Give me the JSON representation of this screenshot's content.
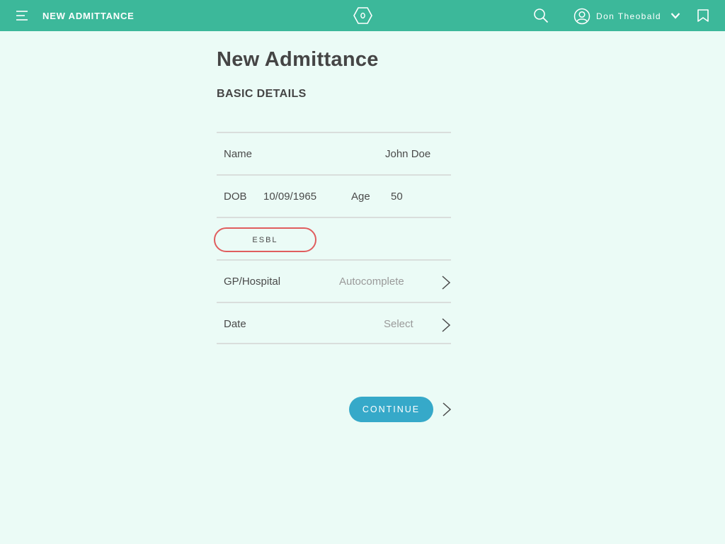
{
  "header": {
    "title": "NEW ADMITTANCE",
    "user_name": "Don Theobald",
    "icons": [
      "menu-icon",
      "hexagon-logo-icon",
      "search-icon",
      "user-avatar-icon",
      "chevron-down-icon",
      "bookmark-icon"
    ]
  },
  "main": {
    "page_title": "New Admittance",
    "section_title": "BASIC DETAILS",
    "name_row": {
      "label": "Name",
      "value": "John Doe"
    },
    "dob_row": {
      "dob_label": "DOB",
      "dob_value": "10/09/1965",
      "age_label": "Age",
      "age_value": "50"
    },
    "esbl_label": "ESBL",
    "gp_row": {
      "label": "GP/Hospital",
      "placeholder": "Autocomplete"
    },
    "date_row": {
      "label": "Date",
      "placeholder": "Select"
    },
    "continue_label": "CONTINUE"
  },
  "colors": {
    "header_bg": "#3cb89a",
    "page_bg": "#ebfbf6",
    "continue_bg": "#36a9c9",
    "esbl_border": "#e05d5e"
  }
}
